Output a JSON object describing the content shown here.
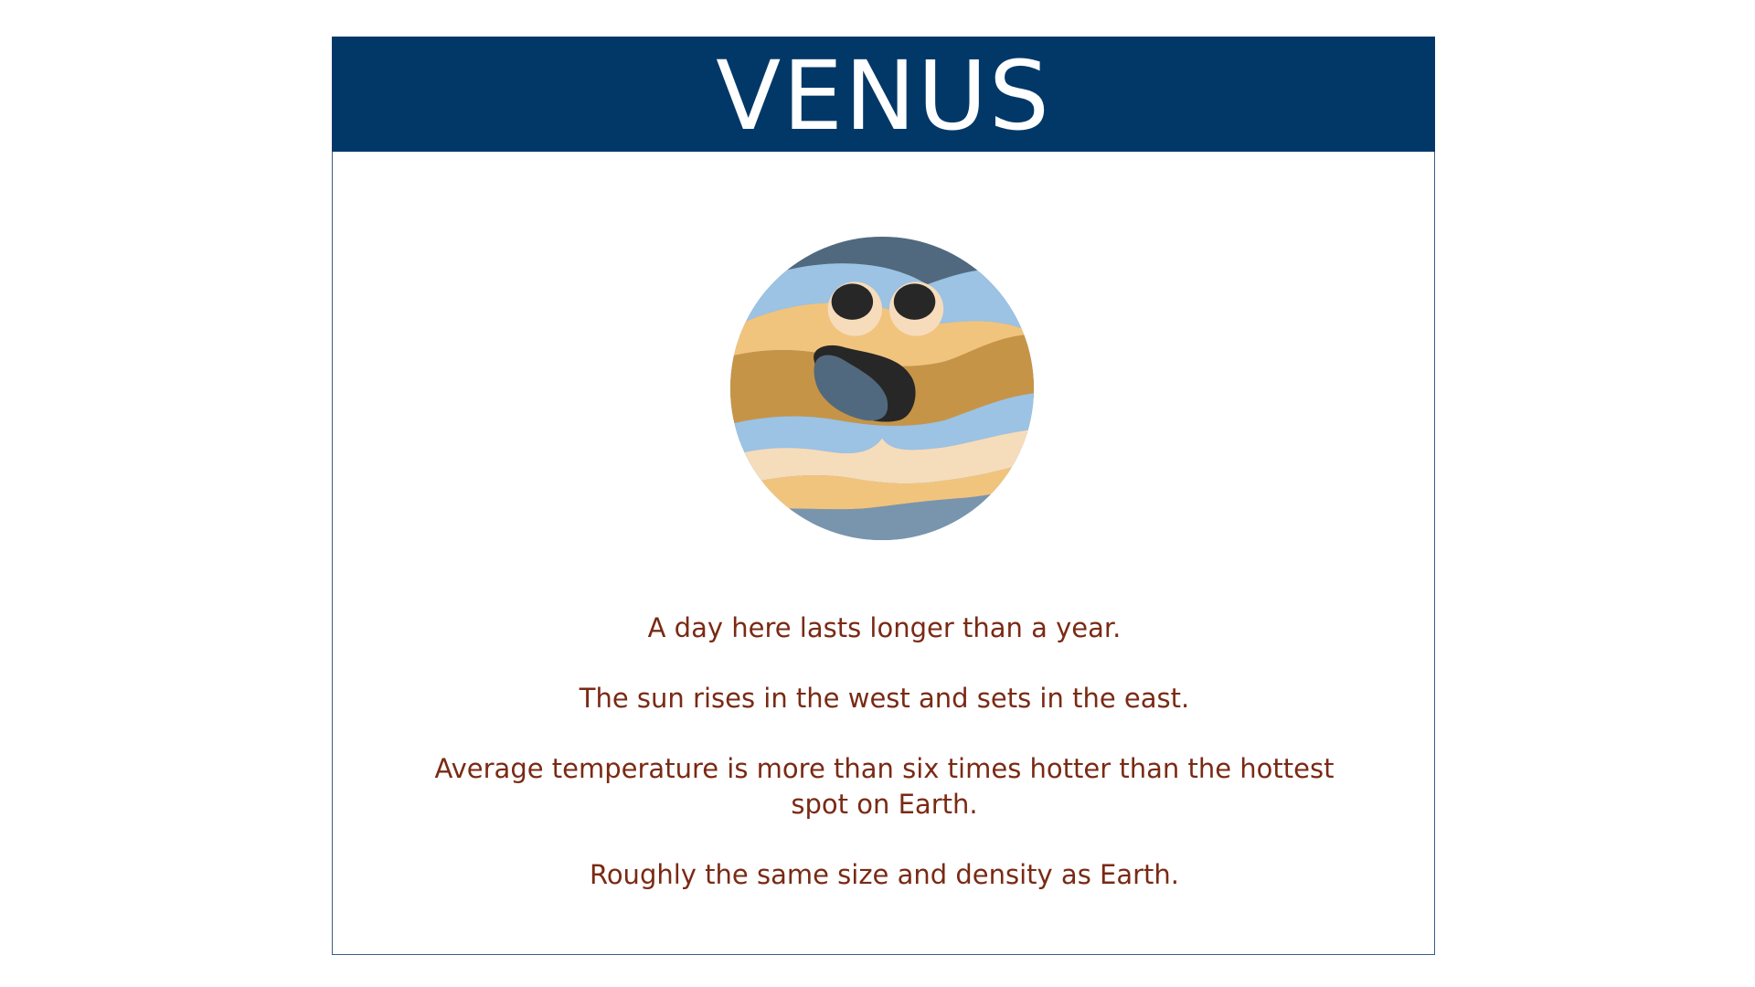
{
  "slide": {
    "title": "VENUS",
    "colors": {
      "header_bg": "#023868",
      "title_text": "#ffffff",
      "fact_text": "#7a2a14",
      "border": "#3a5a8a"
    }
  },
  "illustration": {
    "icon": "venus-planet-face-icon"
  },
  "facts": [
    "A day here lasts longer than a year.",
    "The sun rises in the west and sets in the east.",
    "Average temperature is more than six times hotter than the hottest spot on Earth.",
    "Roughly the same size and density as Earth."
  ]
}
